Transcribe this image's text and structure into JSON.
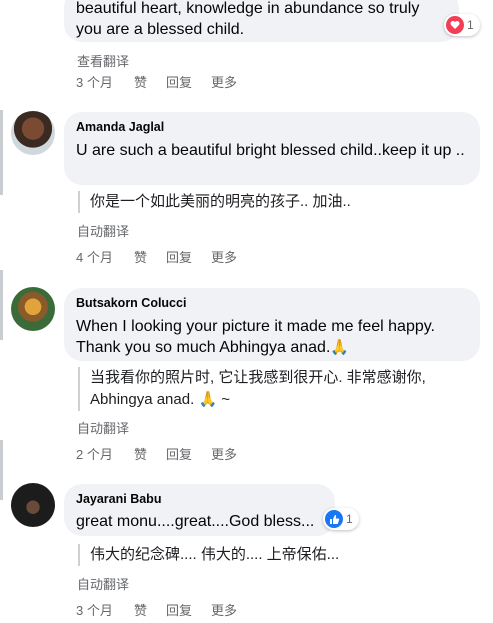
{
  "comments": [
    {
      "text": "beautiful heart, knowledge in abundance so truly you are a blessed child.",
      "translate_link": "查看翻译",
      "time": "3 个月",
      "like": "赞",
      "reply": "回复",
      "more": "更多",
      "reaction": {
        "icon": "heart-icon",
        "count": "1"
      }
    },
    {
      "author": "Amanda Jaglal",
      "text": "U are such a beautiful bright blessed child..keep it up ..",
      "translation": "你是一个如此美丽的明亮的孩子.. 加油..",
      "auto_translate": "自动翻译",
      "time": "4 个月",
      "like": "赞",
      "reply": "回复",
      "more": "更多"
    },
    {
      "author": "Butsakorn Colucci",
      "text_line1": "When I looking your picture it made me feel happy.",
      "text_line2": "Thank you so much Abhingya anad.",
      "translation_line1": "当我看你的照片时, 它让我感到很开心. 非常感谢你,",
      "translation_line2": "Abhingya anad.",
      "translation_suffix": "~",
      "auto_translate": "自动翻译",
      "time": "2 个月",
      "like": "赞",
      "reply": "回复",
      "more": "更多",
      "emoji": "🙏"
    },
    {
      "author": "Jayarani Babu",
      "text": "great monu....great....God bless...",
      "translation": "伟大的纪念碑.... 伟大的.... 上帝保佑...",
      "auto_translate": "自动翻译",
      "time": "3 个月",
      "like": "赞",
      "reply": "回复",
      "more": "更多",
      "reaction": {
        "icon": "thumbs-up-icon",
        "count": "1"
      }
    }
  ],
  "colors": {
    "link_gray": "#65676b",
    "bubble": "#f0f2f5",
    "like_blue": "#1877f2",
    "love_red": "#f33e58"
  }
}
